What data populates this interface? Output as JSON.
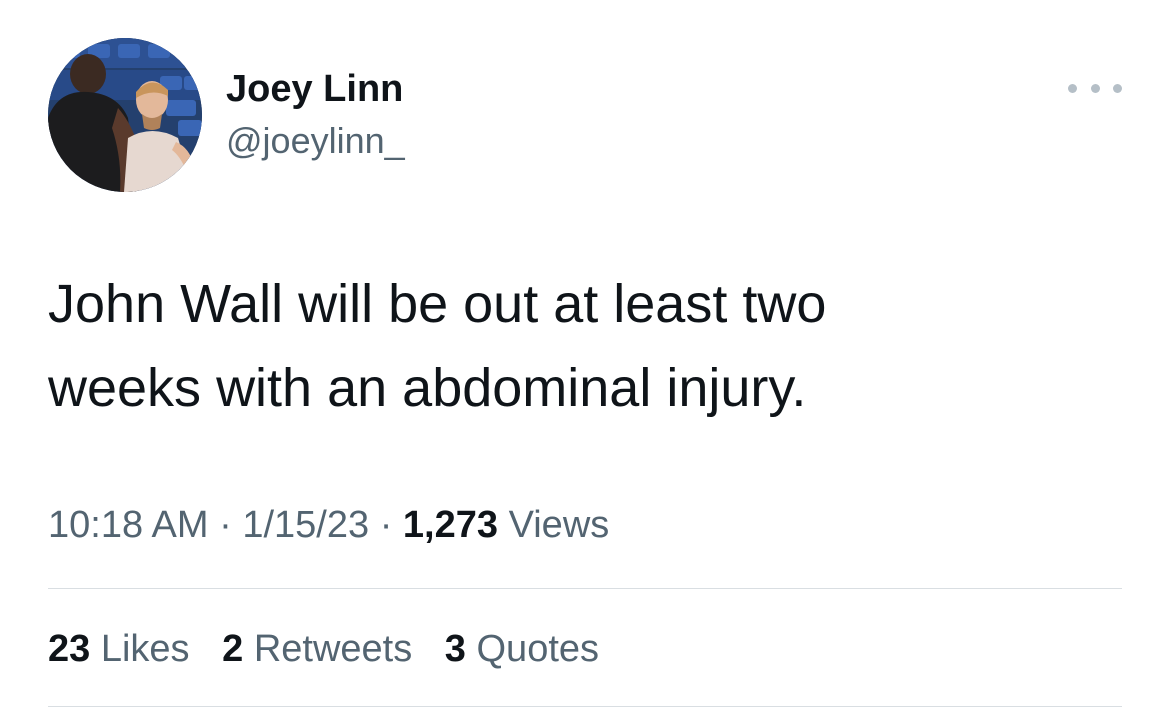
{
  "author": {
    "display_name": "Joey Linn",
    "handle": "@joeylinn_",
    "avatar_icon": "profile-photo-avatar"
  },
  "menu": {
    "icon": "more-options-icon"
  },
  "tweet": {
    "text_line1": "John Wall will be out at least two",
    "text_line2": "weeks with an abdominal injury."
  },
  "meta": {
    "time": "10:18 AM",
    "separator1": "·",
    "date": "1/15/23",
    "separator2": "·",
    "views_count": "1,273",
    "views_label": "Views"
  },
  "stats": {
    "likes_count": "23",
    "likes_label": "Likes",
    "retweets_count": "2",
    "retweets_label": "Retweets",
    "quotes_count": "3",
    "quotes_label": "Quotes"
  },
  "colors": {
    "primary_text": "#0f1419",
    "secondary_text": "#536471",
    "divider": "#d9dee2",
    "background": "#ffffff"
  }
}
